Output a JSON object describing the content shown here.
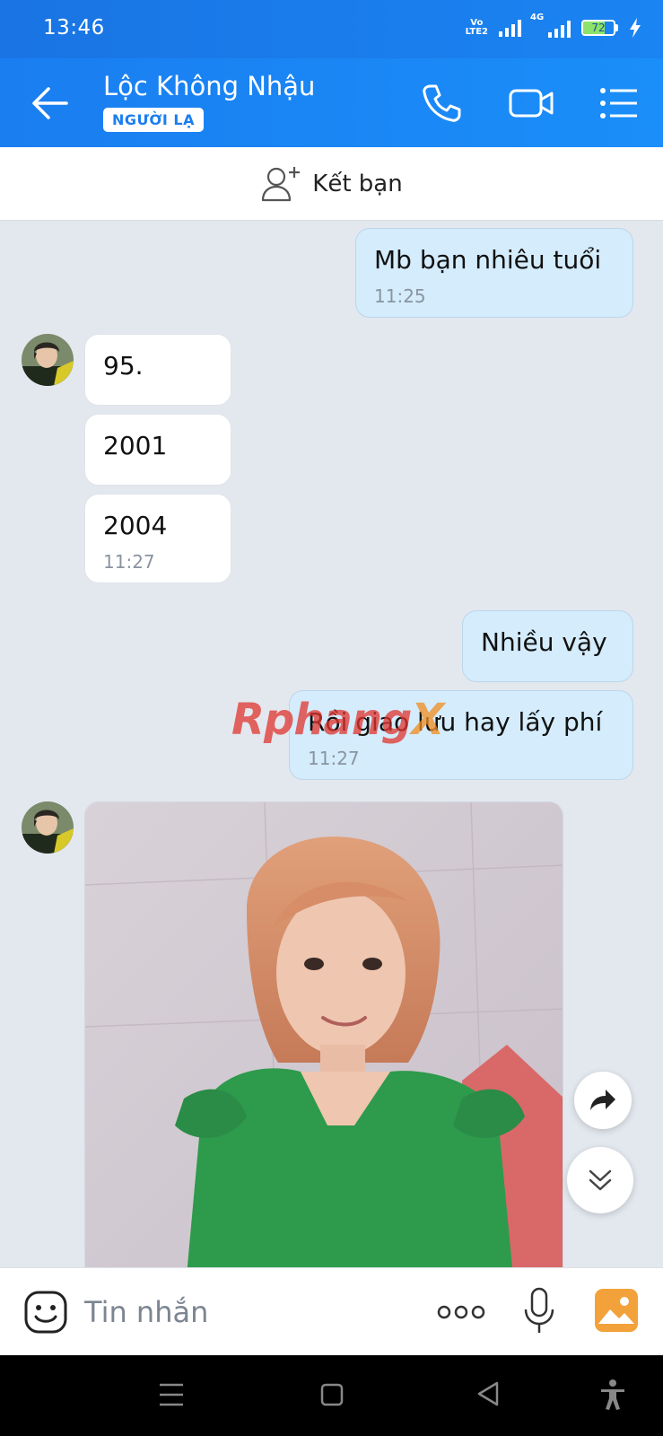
{
  "status": {
    "time": "13:46",
    "volte": "Vo\nLTE2",
    "network": "4G",
    "battery": "72",
    "battery_level": 0.72
  },
  "header": {
    "contact_name": "Lộc Không Nhậu",
    "badge": "NGƯỜI LẠ"
  },
  "add_friend": {
    "label": "Kết bạn"
  },
  "messages": [
    {
      "direction": "out",
      "text": "Mb bạn nhiêu tuổi",
      "time": "11:25"
    },
    {
      "direction": "in",
      "text": "95."
    },
    {
      "direction": "in",
      "text": "2001"
    },
    {
      "direction": "in",
      "text": "2004",
      "time": "11:27"
    },
    {
      "direction": "out",
      "text": "Nhiều vậy"
    },
    {
      "direction": "out",
      "text": "Rồi giao lưu hay lấy phí",
      "time": "11:27"
    }
  ],
  "watermark": {
    "part1": "Rphang",
    "part2": "X"
  },
  "input": {
    "placeholder": "Tin nhắn"
  },
  "colors": {
    "header": "#1a7ef0",
    "outgoing_bubble": "#d4ecfc",
    "incoming_bubble": "#ffffff",
    "background": "#e3e8ef"
  }
}
